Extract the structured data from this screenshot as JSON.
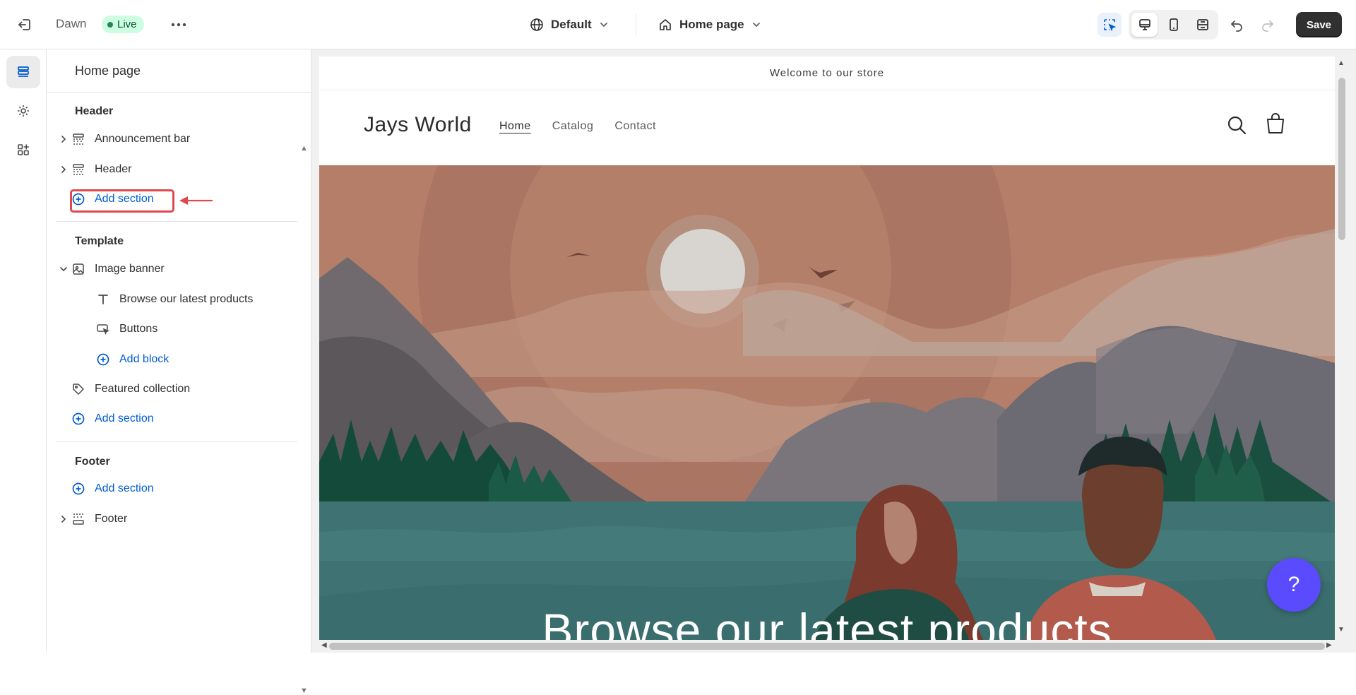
{
  "topbar": {
    "theme_name": "Dawn",
    "status": "Live",
    "language": "Default",
    "page": "Home page",
    "save_label": "Save"
  },
  "sidebar": {
    "title": "Home page",
    "groups": {
      "header": {
        "label": "Header",
        "items": [
          "Announcement bar",
          "Header"
        ],
        "add_label": "Add section"
      },
      "template": {
        "label": "Template",
        "image_banner": "Image banner",
        "blocks": [
          "Browse our latest products",
          "Buttons"
        ],
        "add_block_label": "Add block",
        "featured": "Featured collection",
        "add_label": "Add section"
      },
      "footer": {
        "label": "Footer",
        "add_label": "Add section",
        "items": [
          "Footer"
        ]
      }
    }
  },
  "preview": {
    "announcement": "Welcome to our store",
    "store_name": "Jays World",
    "nav": [
      "Home",
      "Catalog",
      "Contact"
    ],
    "hero_title": "Browse our latest products",
    "help": "?"
  },
  "colors": {
    "accent_blue": "#005bd3",
    "highlight_red": "#e0484e",
    "live_green": "#29845a",
    "help_purple": "#5b4bff"
  },
  "icons": {
    "exit": "exit-icon",
    "more": "ellipsis-icon",
    "globe": "globe-icon",
    "home": "home-icon",
    "inspector": "inspector-icon",
    "desktop": "desktop-icon",
    "mobile": "mobile-icon",
    "fullwidth": "fullwidth-icon",
    "undo": "undo-icon",
    "redo": "redo-icon",
    "sections": "sections-icon",
    "settings": "gear-icon",
    "apps": "apps-icon"
  }
}
